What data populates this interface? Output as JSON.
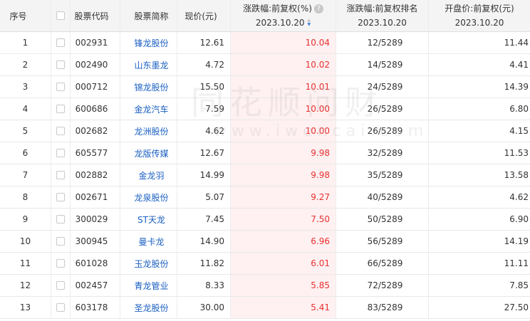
{
  "headers": {
    "index": "序号",
    "code": "股票代码",
    "name": "股票简称",
    "price": "现价(元)",
    "change_title": "涨跌幅:前复权(%)",
    "change_date": "2023.10.20",
    "rank_title": "涨跌幅:前复权排名",
    "rank_date": "2023.10.20",
    "open_title": "开盘价:前复权(元)",
    "open_date": "2023.10.20",
    "help_glyph": "?"
  },
  "watermark": {
    "cn": "同花顺问财",
    "url": "www.iwencai.com"
  },
  "colors": {
    "rise_red": "#e93030",
    "link_blue": "#1a5fc2",
    "header_bg": "#f4f4f4"
  },
  "rows": [
    {
      "index": "1",
      "code": "002931",
      "name": "锋龙股份",
      "price": "12.61",
      "change": "10.04",
      "rank": "12/5289",
      "open": "11.44"
    },
    {
      "index": "2",
      "code": "002490",
      "name": "山东墨龙",
      "price": "4.72",
      "change": "10.02",
      "rank": "14/5289",
      "open": "4.41"
    },
    {
      "index": "3",
      "code": "000712",
      "name": "锦龙股份",
      "price": "15.50",
      "change": "10.01",
      "rank": "24/5289",
      "open": "14.39"
    },
    {
      "index": "4",
      "code": "600686",
      "name": "金龙汽车",
      "price": "7.59",
      "change": "10.00",
      "rank": "26/5289",
      "open": "6.80"
    },
    {
      "index": "5",
      "code": "002682",
      "name": "龙洲股份",
      "price": "4.62",
      "change": "10.00",
      "rank": "26/5289",
      "open": "4.15"
    },
    {
      "index": "6",
      "code": "605577",
      "name": "龙版传媒",
      "price": "12.67",
      "change": "9.98",
      "rank": "32/5289",
      "open": "11.53"
    },
    {
      "index": "7",
      "code": "002882",
      "name": "金龙羽",
      "price": "14.99",
      "change": "9.98",
      "rank": "35/5289",
      "open": "13.58"
    },
    {
      "index": "8",
      "code": "002671",
      "name": "龙泉股份",
      "price": "5.07",
      "change": "9.27",
      "rank": "40/5289",
      "open": "4.62"
    },
    {
      "index": "9",
      "code": "300029",
      "name": "ST天龙",
      "price": "7.45",
      "change": "7.50",
      "rank": "50/5289",
      "open": "6.90"
    },
    {
      "index": "10",
      "code": "300945",
      "name": "曼卡龙",
      "price": "14.90",
      "change": "6.96",
      "rank": "56/5289",
      "open": "14.19"
    },
    {
      "index": "11",
      "code": "601028",
      "name": "玉龙股份",
      "price": "11.82",
      "change": "6.01",
      "rank": "66/5289",
      "open": "11.11"
    },
    {
      "index": "12",
      "code": "002457",
      "name": "青龙管业",
      "price": "8.33",
      "change": "5.85",
      "rank": "72/5289",
      "open": "7.85"
    },
    {
      "index": "13",
      "code": "603178",
      "name": "圣龙股份",
      "price": "30.00",
      "change": "5.41",
      "rank": "83/5289",
      "open": "27.50"
    }
  ]
}
